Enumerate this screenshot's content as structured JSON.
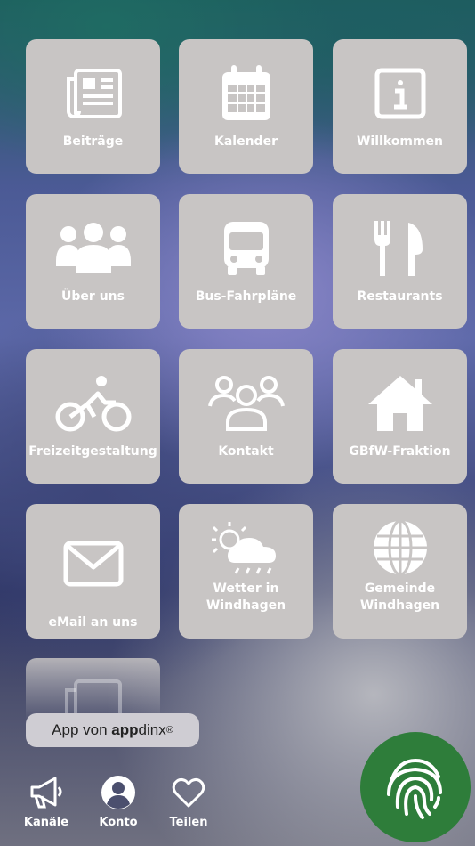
{
  "tiles": [
    {
      "label": "Beiträge",
      "icon": "newspaper-icon"
    },
    {
      "label": "Kalender",
      "icon": "calendar-icon"
    },
    {
      "label": "Willkommen",
      "icon": "info-icon"
    },
    {
      "label": "Über uns",
      "icon": "group-icon"
    },
    {
      "label": "Bus-Fahrpläne",
      "icon": "bus-icon"
    },
    {
      "label": "Restaurants",
      "icon": "fork-knife-icon"
    },
    {
      "label": "Freizeitgestaltung",
      "icon": "bicycle-icon"
    },
    {
      "label": "Kontakt",
      "icon": "people-icon"
    },
    {
      "label": "GBfW-Fraktion",
      "icon": "home-icon"
    },
    {
      "label": "eMail an uns",
      "icon": "mail-icon"
    },
    {
      "label": "Wetter in\nWindhagen",
      "icon": "weather-icon"
    },
    {
      "label": "Gemeinde\nWindhagen",
      "icon": "globe-icon"
    }
  ],
  "badge": {
    "prefix": "App von ",
    "brand_bold": "app",
    "brand_rest": "dinx",
    "mark": "®"
  },
  "nav": [
    {
      "label": "Kanäle",
      "icon": "megaphone-icon"
    },
    {
      "label": "Konto",
      "icon": "account-icon"
    },
    {
      "label": "Teilen",
      "icon": "heart-icon"
    }
  ],
  "fab": {
    "icon": "fingerprint-icon",
    "color": "#2e7d3a"
  },
  "colors": {
    "tile": "#c8c5c4",
    "text": "#ffffff"
  }
}
